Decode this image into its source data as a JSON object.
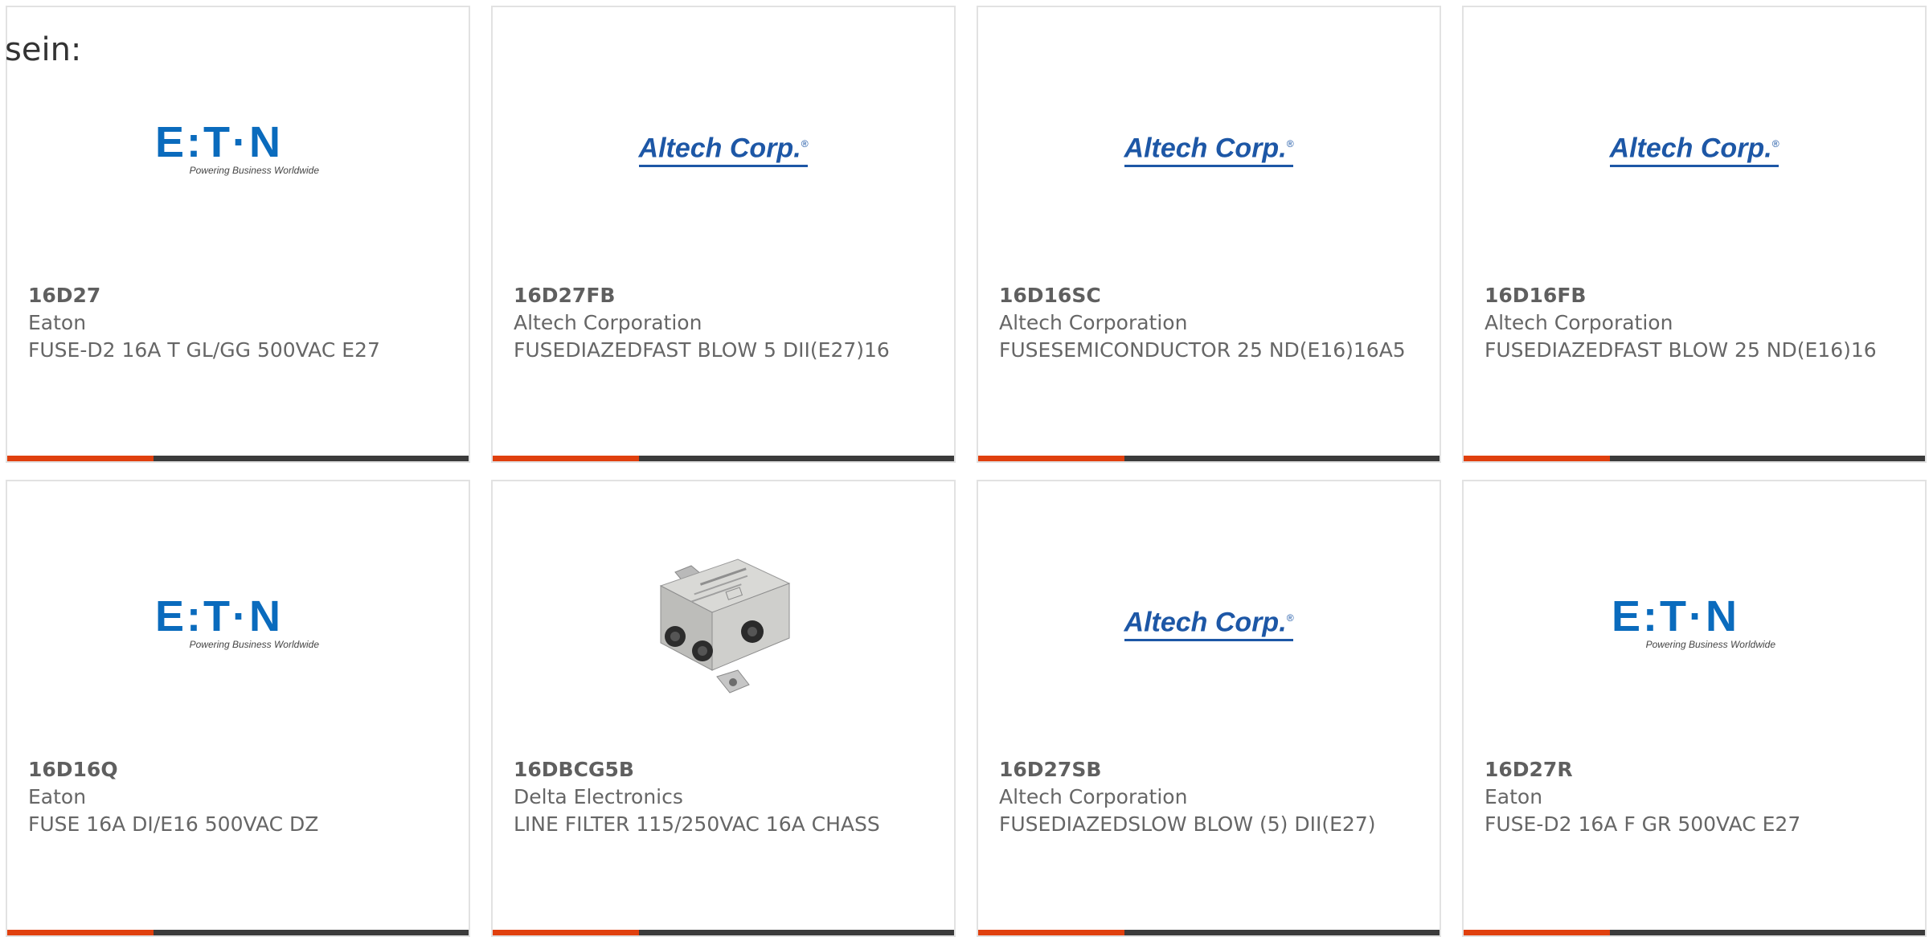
{
  "intro_text": "sein:",
  "logos": {
    "eaton_word": "E:T·N",
    "eaton_tagline": "Powering Business Worldwide",
    "altech_word": "Altech Corp.",
    "altech_mark": "®"
  },
  "colors": {
    "accent": "#e0400e",
    "bar": "#3b3b3b",
    "eaton_blue": "#0a6bbd",
    "altech_blue": "#1d57a6",
    "text": "#666666"
  },
  "products": [
    {
      "part_number": "16D27",
      "manufacturer": "Eaton",
      "description": "FUSE-D2 16A T GL/GG 500VAC E27",
      "logo": "eaton-logo"
    },
    {
      "part_number": "16D27FB",
      "manufacturer": "Altech Corporation",
      "description": "FUSEDIAZEDFAST BLOW 5 DII(E27)16",
      "logo": "altech-logo"
    },
    {
      "part_number": "16D16SC",
      "manufacturer": "Altech Corporation",
      "description": "FUSESEMICONDUCTOR 25 ND(E16)16A5",
      "logo": "altech-logo"
    },
    {
      "part_number": "16D16FB",
      "manufacturer": "Altech Corporation",
      "description": "FUSEDIAZEDFAST BLOW 25 ND(E16)16",
      "logo": "altech-logo"
    },
    {
      "part_number": "16D16Q",
      "manufacturer": "Eaton",
      "description": "FUSE 16A DI/E16 500VAC DZ",
      "logo": "eaton-logo"
    },
    {
      "part_number": "16DBCG5B",
      "manufacturer": "Delta Electronics",
      "description": "LINE FILTER 115/250VAC 16A CHASS",
      "logo": "line-filter-image"
    },
    {
      "part_number": "16D27SB",
      "manufacturer": "Altech Corporation",
      "description": "FUSEDIAZEDSLOW BLOW (5) DII(E27)",
      "logo": "altech-logo"
    },
    {
      "part_number": "16D27R",
      "manufacturer": "Eaton",
      "description": "FUSE-D2 16A F GR 500VAC E27",
      "logo": "eaton-logo"
    }
  ]
}
